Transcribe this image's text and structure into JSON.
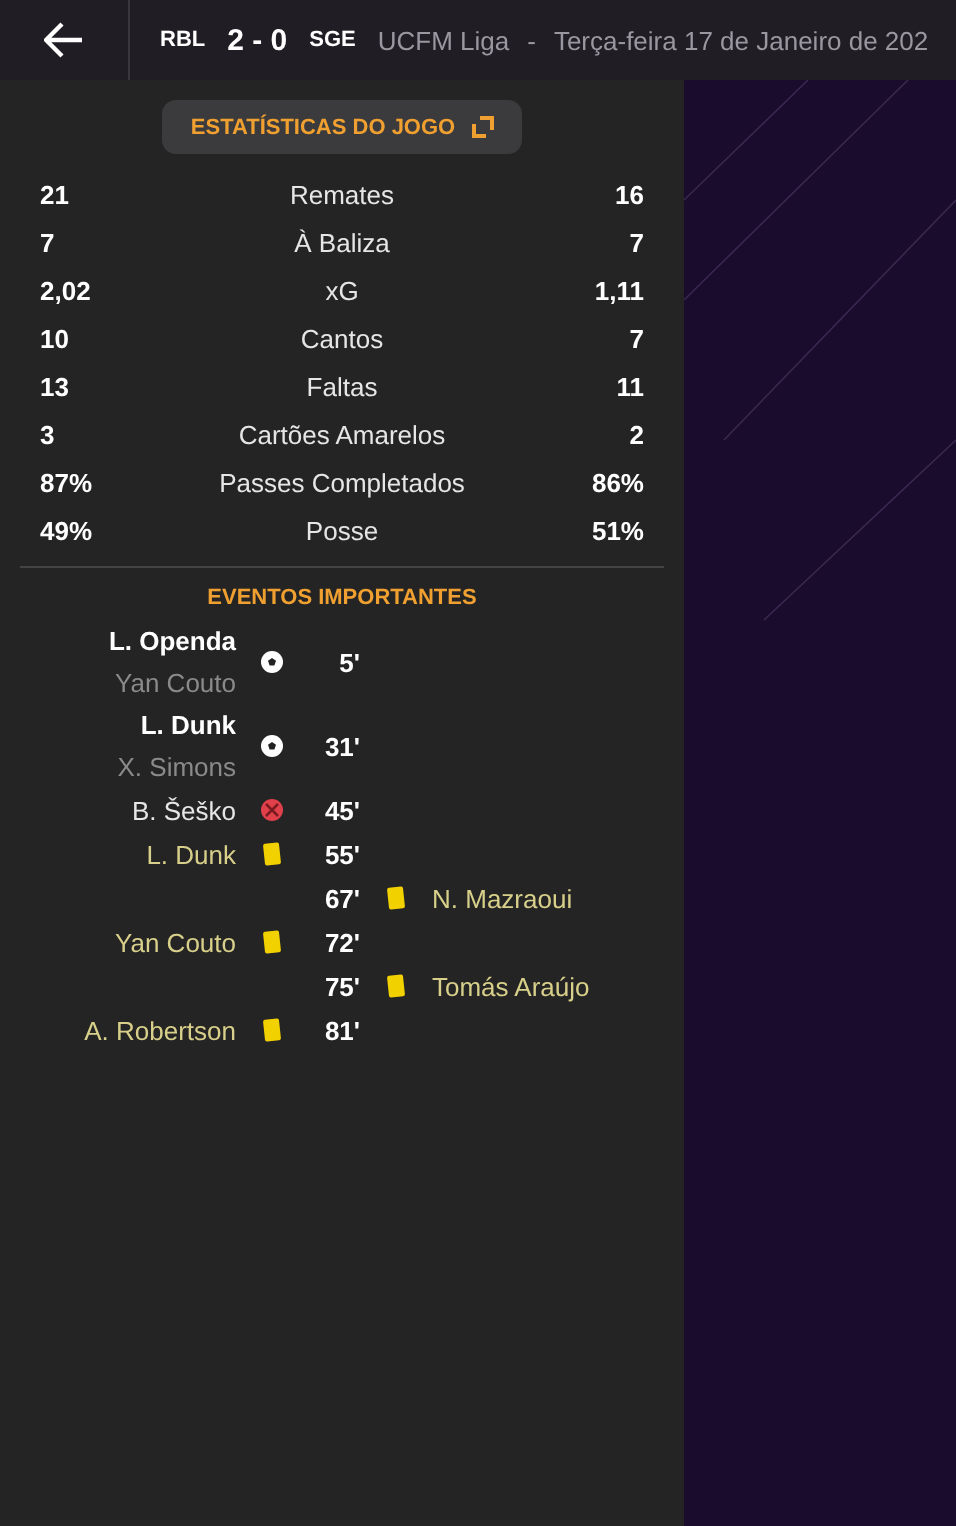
{
  "header": {
    "home": "RBL",
    "score": "2 - 0",
    "away": "SGE",
    "competition": "UCFM Liga",
    "separator": "-",
    "date": "Terça-feira 17 de Janeiro de 202"
  },
  "stats_button": {
    "label": "ESTATÍSTICAS DO JOGO"
  },
  "stats": [
    {
      "home": "21",
      "label": "Remates",
      "away": "16"
    },
    {
      "home": "7",
      "label": "À Baliza",
      "away": "7"
    },
    {
      "home": "2,02",
      "label": "xG",
      "away": "1,11"
    },
    {
      "home": "10",
      "label": "Cantos",
      "away": "7"
    },
    {
      "home": "13",
      "label": "Faltas",
      "away": "11"
    },
    {
      "home": "3",
      "label": "Cartões Amarelos",
      "away": "2"
    },
    {
      "home": "87%",
      "label": "Passes Completados",
      "away": "86%"
    },
    {
      "home": "49%",
      "label": "Posse",
      "away": "51%"
    }
  ],
  "events_title": "EVENTOS IMPORTANTES",
  "events": [
    {
      "away_team": false,
      "kind": "goal",
      "player": "L. Openda",
      "assist": "Yan Couto",
      "minute": "5'"
    },
    {
      "away_team": false,
      "kind": "goal",
      "player": "L. Dunk",
      "assist": "X. Simons",
      "minute": "31'"
    },
    {
      "away_team": false,
      "kind": "miss",
      "player": "B. Šeško",
      "minute": "45'"
    },
    {
      "away_team": false,
      "kind": "yellow",
      "player": "L. Dunk",
      "minute": "55'"
    },
    {
      "away_team": true,
      "kind": "yellow",
      "player": "N. Mazraoui",
      "minute": "67'"
    },
    {
      "away_team": false,
      "kind": "yellow",
      "player": "Yan Couto",
      "minute": "72'"
    },
    {
      "away_team": true,
      "kind": "yellow",
      "player": "Tomás Araújo",
      "minute": "75'"
    },
    {
      "away_team": false,
      "kind": "yellow",
      "player": "A. Robertson",
      "minute": "81'"
    }
  ]
}
